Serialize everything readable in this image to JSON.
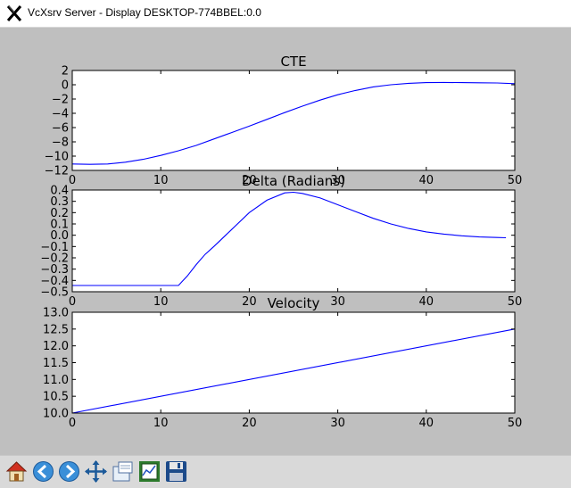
{
  "window": {
    "title": "VcXsrv Server - Display DESKTOP-774BBEL:0.0"
  },
  "toolbar": {
    "buttons": [
      {
        "name": "home-button",
        "icon": "home-icon"
      },
      {
        "name": "back-button",
        "icon": "arrow-left-icon"
      },
      {
        "name": "forward-button",
        "icon": "arrow-right-icon"
      },
      {
        "name": "pan-button",
        "icon": "move-arrows-icon"
      },
      {
        "name": "zoom-button",
        "icon": "zoom-rect-icon"
      },
      {
        "name": "subplots-button",
        "icon": "subplots-config-icon"
      },
      {
        "name": "save-button",
        "icon": "floppy-disk-icon"
      }
    ]
  },
  "chart_data": [
    {
      "type": "line",
      "title": "CTE",
      "xlim": [
        0,
        50
      ],
      "ylim": [
        -12,
        2
      ],
      "xticks": [
        "0",
        "10",
        "20",
        "30",
        "40",
        "50"
      ],
      "yticks": [
        "2",
        "0",
        "−2",
        "−4",
        "−6",
        "−8",
        "−10",
        "−12"
      ],
      "color": "#0000ff",
      "series": [
        {
          "x": [
            0,
            2,
            4,
            6,
            8,
            10,
            12,
            14,
            16,
            18,
            20,
            22,
            24,
            26,
            28,
            30,
            32,
            34,
            36,
            38,
            40,
            42,
            44,
            46,
            48,
            50
          ],
          "values": [
            -11.1,
            -11.15,
            -11.1,
            -10.85,
            -10.45,
            -9.9,
            -9.25,
            -8.5,
            -7.6,
            -6.7,
            -5.8,
            -4.85,
            -3.9,
            -3.0,
            -2.15,
            -1.4,
            -0.8,
            -0.3,
            0.0,
            0.2,
            0.3,
            0.32,
            0.3,
            0.28,
            0.25,
            0.15
          ]
        }
      ]
    },
    {
      "type": "line",
      "title": "Delta (Radians)",
      "xlim": [
        0,
        50
      ],
      "ylim": [
        -0.5,
        0.4
      ],
      "xticks": [
        "0",
        "10",
        "20",
        "30",
        "40",
        "50"
      ],
      "yticks": [
        "0.4",
        "0.3",
        "0.2",
        "0.1",
        "0.0",
        "−0.1",
        "−0.2",
        "−0.3",
        "−0.4",
        "−0.5"
      ],
      "color": "#0000ff",
      "series": [
        {
          "x": [
            0,
            2,
            4,
            6,
            8,
            10,
            12,
            13,
            14,
            15,
            16,
            18,
            20,
            22,
            24,
            25,
            26,
            28,
            30,
            32,
            34,
            36,
            38,
            40,
            42,
            44,
            46,
            48,
            49
          ],
          "values": [
            -0.445,
            -0.445,
            -0.445,
            -0.445,
            -0.445,
            -0.445,
            -0.445,
            -0.36,
            -0.26,
            -0.17,
            -0.1,
            0.05,
            0.2,
            0.31,
            0.375,
            0.38,
            0.37,
            0.33,
            0.27,
            0.21,
            0.15,
            0.1,
            0.06,
            0.03,
            0.01,
            -0.005,
            -0.015,
            -0.02,
            -0.022
          ]
        }
      ]
    },
    {
      "type": "line",
      "title": "Velocity",
      "xlim": [
        0,
        50
      ],
      "ylim": [
        10.0,
        13.0
      ],
      "xticks": [
        "0",
        "10",
        "20",
        "30",
        "40",
        "50"
      ],
      "yticks": [
        "13.0",
        "12.5",
        "12.0",
        "11.5",
        "11.0",
        "10.5",
        "10.0"
      ],
      "color": "#0000ff",
      "series": [
        {
          "x": [
            0,
            50
          ],
          "values": [
            10.0,
            12.5
          ]
        }
      ]
    }
  ]
}
